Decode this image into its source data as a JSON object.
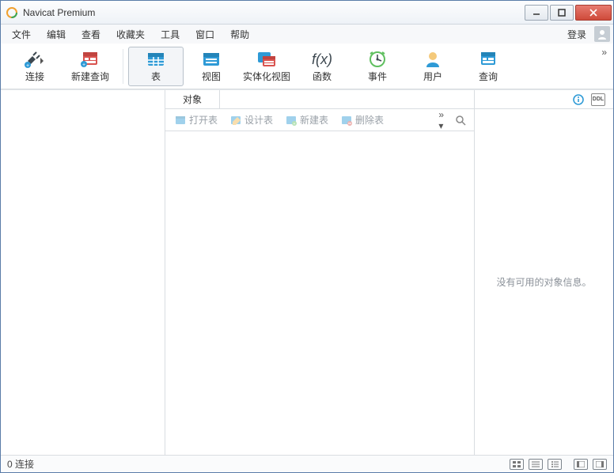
{
  "window": {
    "title": "Navicat Premium"
  },
  "menu": {
    "items": [
      "文件",
      "编辑",
      "查看",
      "收藏夹",
      "工具",
      "窗口",
      "帮助"
    ],
    "login": "登录"
  },
  "toolbar": {
    "connect": "连接",
    "new_query": "新建查询",
    "table": "表",
    "view": "视图",
    "materialized_view": "实体化视图",
    "function": "函数",
    "event": "事件",
    "user": "用户",
    "query": "查询"
  },
  "mid": {
    "tab_objects": "对象",
    "actions": {
      "open_table": "打开表",
      "design_table": "设计表",
      "new_table": "新建表",
      "delete_table": "删除表"
    }
  },
  "right": {
    "empty": "没有可用的对象信息。"
  },
  "status": {
    "connections": "0 连接"
  }
}
